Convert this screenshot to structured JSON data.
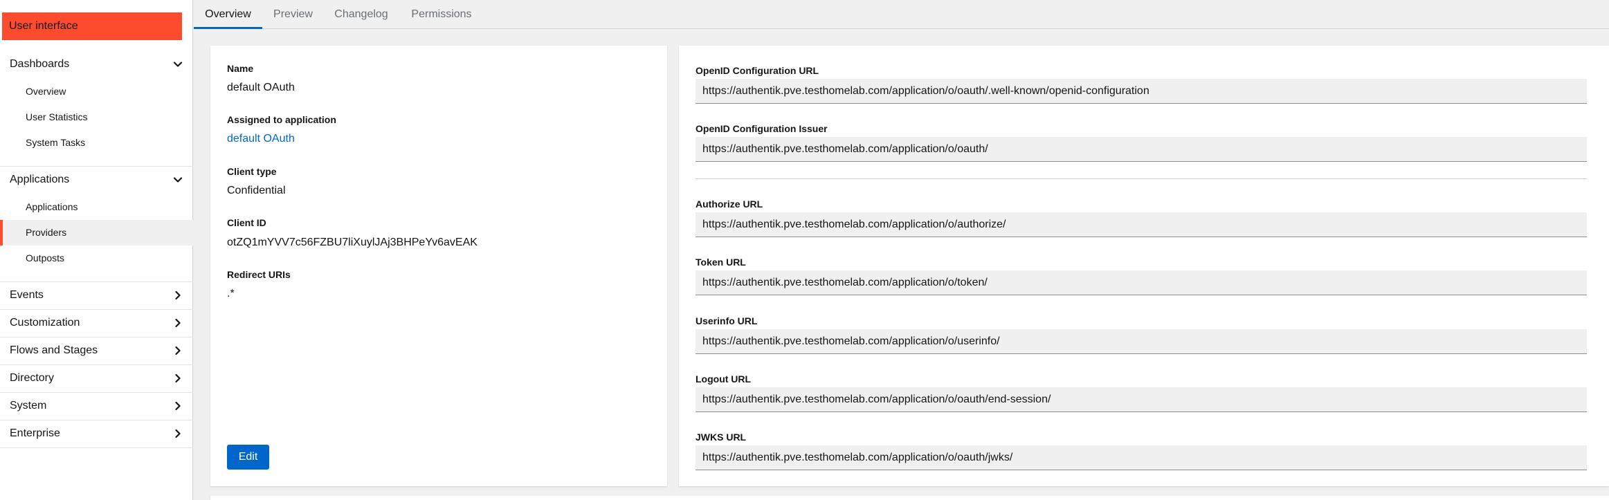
{
  "sidebar": {
    "banner": "User interface",
    "groups": [
      {
        "label": "Dashboards",
        "chevron": "chevron-down-icon"
      },
      {
        "label": "Applications",
        "chevron": "chevron-down-icon"
      },
      {
        "label": "Events",
        "chevron": "chevron-right-icon"
      },
      {
        "label": "Customization",
        "chevron": "chevron-right-icon"
      },
      {
        "label": "Flows and Stages",
        "chevron": "chevron-right-icon"
      },
      {
        "label": "Directory",
        "chevron": "chevron-right-icon"
      },
      {
        "label": "System",
        "chevron": "chevron-right-icon"
      },
      {
        "label": "Enterprise",
        "chevron": "chevron-right-icon"
      }
    ],
    "dashboards_items": [
      "Overview",
      "User Statistics",
      "System Tasks"
    ],
    "applications_items": [
      "Applications",
      "Providers",
      "Outposts"
    ],
    "active_item": "Providers",
    "accent_color": "#fd4b2d"
  },
  "tabs": [
    {
      "label": "Overview",
      "active": true
    },
    {
      "label": "Preview",
      "active": false
    },
    {
      "label": "Changelog",
      "active": false
    },
    {
      "label": "Permissions",
      "active": false
    }
  ],
  "details": {
    "name_label": "Name",
    "name_value": "default OAuth",
    "assigned_label": "Assigned to application",
    "assigned_value": "default OAuth",
    "client_type_label": "Client type",
    "client_type_value": "Confidential",
    "client_id_label": "Client ID",
    "client_id_value": "otZQ1mYVV7c56FZBU7liXuylJAj3BHPeYv6avEAK",
    "redirect_label": "Redirect URIs",
    "redirect_value": ".*",
    "edit_label": "Edit"
  },
  "urls": {
    "openid_config_label": "OpenID Configuration URL",
    "openid_config_value": "https://authentik.pve.testhomelab.com/application/o/oauth/.well-known/openid-configuration",
    "openid_issuer_label": "OpenID Configuration Issuer",
    "openid_issuer_value": "https://authentik.pve.testhomelab.com/application/o/oauth/",
    "authorize_label": "Authorize URL",
    "authorize_value": "https://authentik.pve.testhomelab.com/application/o/authorize/",
    "token_label": "Token URL",
    "token_value": "https://authentik.pve.testhomelab.com/application/o/token/",
    "userinfo_label": "Userinfo URL",
    "userinfo_value": "https://authentik.pve.testhomelab.com/application/o/userinfo/",
    "logout_label": "Logout URL",
    "logout_value": "https://authentik.pve.testhomelab.com/application/o/oauth/end-session/",
    "jwks_label": "JWKS URL",
    "jwks_value": "https://authentik.pve.testhomelab.com/application/o/oauth/jwks/"
  },
  "colors": {
    "primary": "#0066cc",
    "banner": "#fd4b2d"
  }
}
